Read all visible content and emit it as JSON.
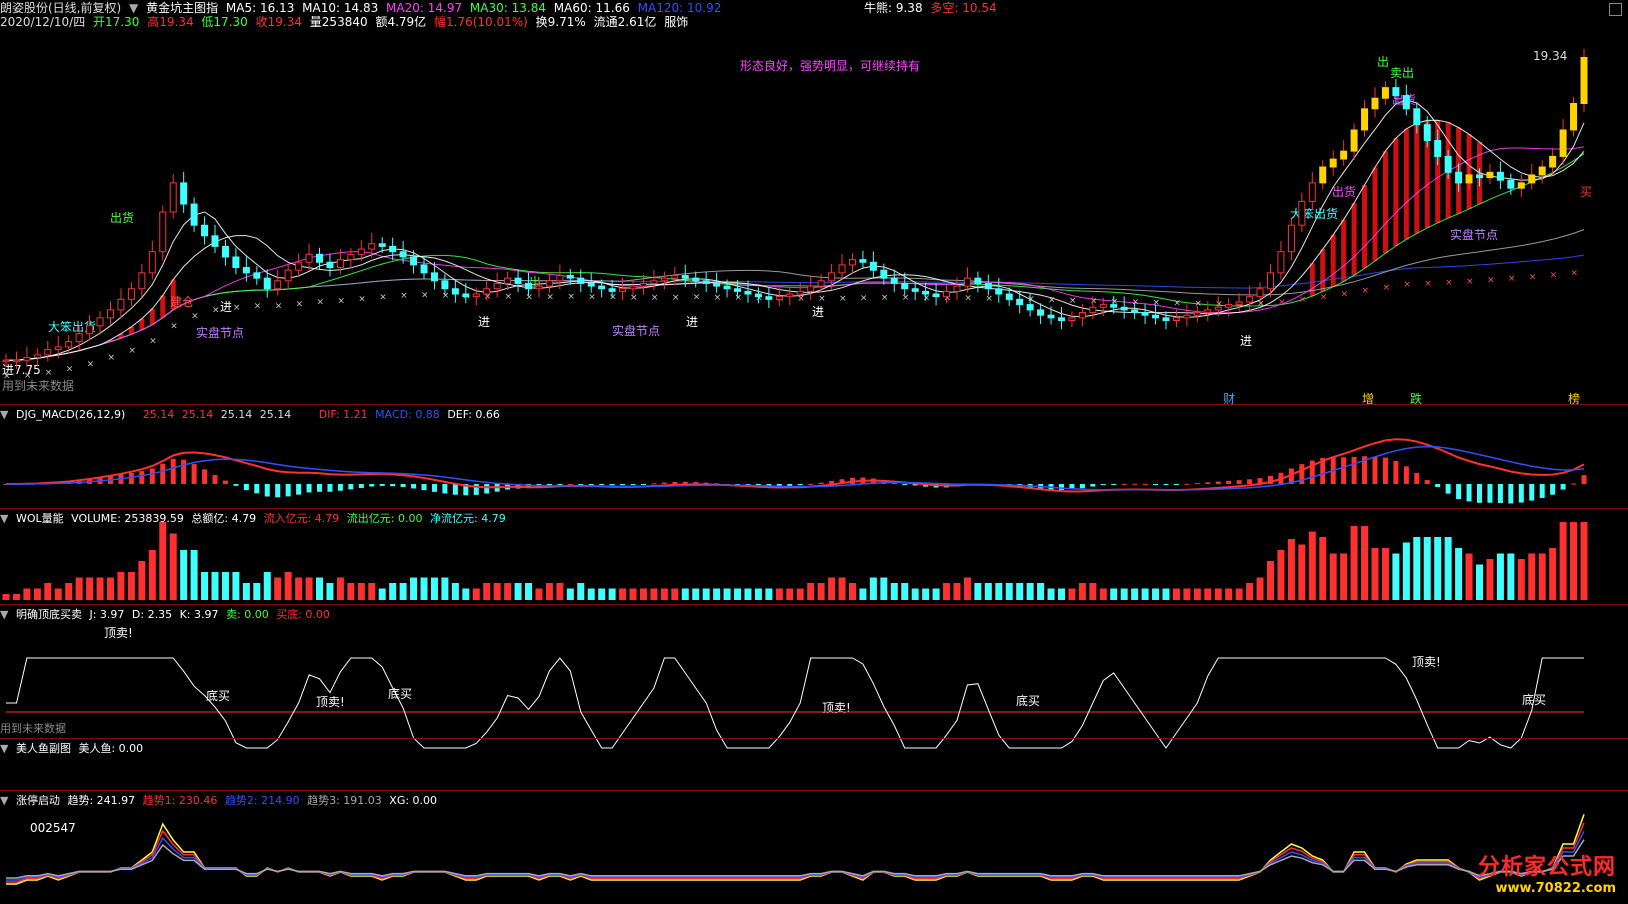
{
  "header": {
    "stock_title": "朗姿股份(日线,前复权)",
    "indicator_title": "黄金坑主图指",
    "ma": [
      {
        "label": "MA5: 16.13",
        "color": "#ffffff"
      },
      {
        "label": "MA10: 14.83",
        "color": "#ffffff"
      },
      {
        "label": "MA20: 14.97",
        "color": "#ff40ff"
      },
      {
        "label": "MA30: 13.84",
        "color": "#40ff40"
      },
      {
        "label": "MA60: 11.66",
        "color": "#ffffff"
      },
      {
        "label": "MA120: 10.92",
        "color": "#3050ff"
      }
    ],
    "niu_label": "牛熊: 9.38",
    "duokong_label": "多空: 10.54",
    "date": "2020/12/10/四",
    "quote": [
      {
        "label": "开17.30",
        "color": "#40ff40"
      },
      {
        "label": "高19.34",
        "color": "#ff3030"
      },
      {
        "label": "低17.30",
        "color": "#40ff40"
      },
      {
        "label": "收19.34",
        "color": "#ff3030"
      },
      {
        "label": "量253840",
        "color": "#ffffff"
      },
      {
        "label": "额4.79亿",
        "color": "#ffffff"
      },
      {
        "label": "幅1.76(10.01%)",
        "color": "#ff3030"
      },
      {
        "label": "换9.71%",
        "color": "#ffffff"
      },
      {
        "label": "流通2.61亿",
        "color": "#ffffff"
      },
      {
        "label": "服饰",
        "color": "#ffffff"
      }
    ],
    "comment": "形态良好，强势明显，可继续持有",
    "future_note": "用到未来数据"
  },
  "panels": {
    "macd": {
      "title": "DJG_MACD(26,12,9)",
      "nums": [
        "25.14",
        "25.14",
        "25.14",
        "25.14"
      ],
      "dif": "DIF: 1.21",
      "macd": "MACD: 0.88",
      "def": "DEF: 0.66"
    },
    "wol": {
      "title": "WOL量能",
      "volume": "VOLUME: 253839.59",
      "amount": "总额亿: 4.79",
      "inflow": "流入亿元: 4.79",
      "outflow": "流出亿元: 0.00",
      "net": "净流亿元: 4.79"
    },
    "kdj": {
      "title": "明确顶底买卖",
      "j": "J: 3.97",
      "d": "D: 2.35",
      "k": "K: 3.97",
      "sell": "卖: 0.00",
      "buy": "买底: 0.00",
      "note": "用到未来数据"
    },
    "mermaid": {
      "title": "美人鱼副图",
      "value": "美人鱼: 0.00"
    },
    "zt": {
      "title": "涨停启动",
      "trend": "趋势: 241.97",
      "trend1": "趋势1: 230.46",
      "trend2": "趋势2: 214.90",
      "trend3": "趋势3: 191.03",
      "xg": "XG: 0.00",
      "number": "002547"
    }
  },
  "labels": {
    "price_max": "19.34",
    "price_start": "进7.75",
    "chu_huo": "出货",
    "da_ben_chu_huo": "大笨出货",
    "jian_cang": "建仓",
    "jin": "进",
    "chu": "出",
    "sell": "卖出",
    "buy": "买",
    "shi_pan": "实盘节点",
    "ding_mai": "顶卖!",
    "di_mai": "底买",
    "markers": [
      "财",
      "增",
      "跌",
      "榜"
    ]
  },
  "watermark": {
    "site_name": "分析家公式网",
    "site_url": "www.70822.com"
  },
  "chart_data": {
    "type": "candlestick",
    "y_range": [
      7,
      20
    ],
    "last_close": 19.34,
    "closes": [
      7.9,
      7.9,
      8.0,
      8.1,
      8.3,
      8.4,
      8.6,
      8.9,
      9.2,
      9.5,
      9.8,
      10.2,
      10.6,
      11.2,
      12.0,
      13.5,
      14.6,
      13.8,
      13.0,
      12.6,
      12.2,
      11.8,
      11.4,
      11.2,
      11.0,
      10.6,
      10.9,
      11.3,
      11.6,
      11.9,
      11.6,
      11.4,
      11.7,
      11.9,
      12.1,
      12.3,
      12.2,
      12.0,
      11.8,
      11.5,
      11.2,
      10.9,
      10.6,
      10.4,
      10.3,
      10.4,
      10.6,
      10.8,
      11.0,
      10.8,
      10.6,
      10.7,
      10.9,
      11.1,
      11.0,
      10.8,
      10.7,
      10.6,
      10.5,
      10.6,
      10.7,
      10.8,
      10.9,
      11.0,
      11.1,
      11.0,
      10.9,
      10.8,
      10.7,
      10.6,
      10.5,
      10.4,
      10.3,
      10.2,
      10.3,
      10.4,
      10.5,
      10.7,
      10.9,
      11.2,
      11.5,
      11.7,
      11.6,
      11.3,
      11.0,
      10.8,
      10.6,
      10.5,
      10.4,
      10.3,
      10.5,
      10.7,
      11.0,
      10.8,
      10.6,
      10.4,
      10.2,
      10.0,
      9.8,
      9.6,
      9.5,
      9.4,
      9.5,
      9.7,
      9.9,
      10.0,
      9.9,
      9.8,
      9.7,
      9.6,
      9.5,
      9.4,
      9.5,
      9.6,
      9.7,
      9.8,
      9.9,
      10.0,
      10.1,
      10.3,
      10.6,
      11.2,
      12.0,
      13.0,
      13.9,
      14.6,
      15.2,
      15.5,
      15.8,
      16.6,
      17.4,
      17.8,
      18.2,
      17.9,
      17.4,
      16.8,
      16.2,
      15.6,
      15.0,
      14.6,
      14.9,
      14.8,
      15.0,
      14.7,
      14.4,
      14.6,
      14.9,
      15.2,
      15.6,
      16.6,
      17.6,
      19.34
    ]
  }
}
